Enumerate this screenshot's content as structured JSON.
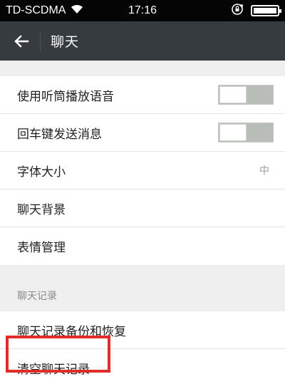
{
  "status_bar": {
    "carrier": "TD-SCDMA",
    "time": "17:16",
    "icons": [
      "wifi-icon",
      "rotation-lock-icon",
      "battery-icon"
    ]
  },
  "title_bar": {
    "back_icon": "arrow-left-icon",
    "title": "聊天"
  },
  "settings": {
    "items": [
      {
        "label": "使用听筒播放语音",
        "control": "switch",
        "on": false
      },
      {
        "label": "回车键发送消息",
        "control": "switch",
        "on": false
      },
      {
        "label": "字体大小",
        "value": "中"
      },
      {
        "label": "聊天背景"
      },
      {
        "label": "表情管理"
      }
    ]
  },
  "chat_history": {
    "section_title": "聊天记录",
    "items": [
      {
        "label": "聊天记录备份和恢复"
      },
      {
        "label": "清空聊天记录",
        "highlighted": true
      }
    ]
  },
  "colors": {
    "status_bar": "#050505",
    "title_bar": "#353b3e",
    "background": "#efefef",
    "highlight": "#e12c2c"
  }
}
